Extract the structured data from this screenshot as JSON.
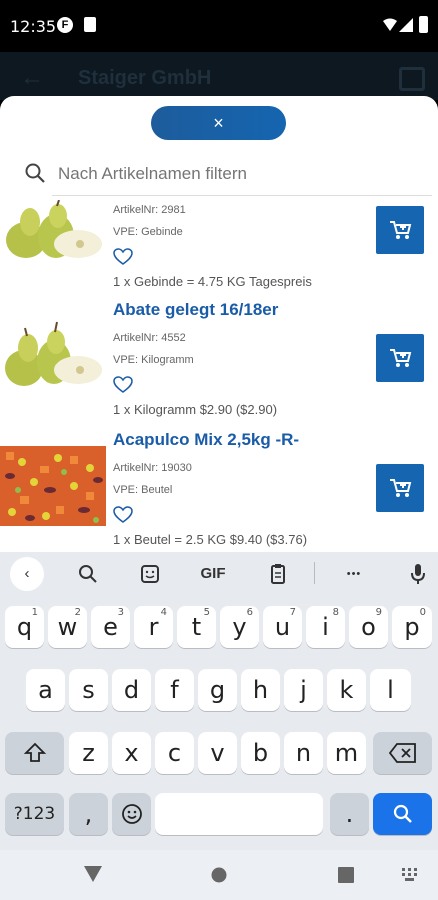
{
  "status": {
    "time": "12:35",
    "app_icon": "F"
  },
  "appbar": {
    "title": "Staiger GmbH"
  },
  "sheet": {
    "close_label": "×",
    "search_placeholder": "Nach Artikelnamen filtern"
  },
  "products": [
    {
      "name": "",
      "artnr": "ArtikelNr: 2981",
      "vpe": "VPE: Gebinde",
      "price": "1 x Gebinde = 4.75 KG Tagespreis"
    },
    {
      "name": "Abate gelegt 16/18er",
      "artnr": "ArtikelNr: 4552",
      "vpe": "VPE: Kilogramm",
      "price": "1 x Kilogramm $2.90 ($2.90)"
    },
    {
      "name": "Acapulco Mix 2,5kg -R-",
      "artnr": "ArtikelNr: 19030",
      "vpe": "VPE: Beutel",
      "price": "1 x Beutel = 2.5 KG  $9.40 ($3.76)"
    }
  ],
  "keyboard": {
    "toolbar": {
      "gif": "GIF",
      "more": "•••"
    },
    "row1": [
      {
        "k": "q",
        "s": "1"
      },
      {
        "k": "w",
        "s": "2"
      },
      {
        "k": "e",
        "s": "3"
      },
      {
        "k": "r",
        "s": "4"
      },
      {
        "k": "t",
        "s": "5"
      },
      {
        "k": "y",
        "s": "6"
      },
      {
        "k": "u",
        "s": "7"
      },
      {
        "k": "i",
        "s": "8"
      },
      {
        "k": "o",
        "s": "9"
      },
      {
        "k": "p",
        "s": "0"
      }
    ],
    "row2": [
      "a",
      "s",
      "d",
      "f",
      "g",
      "h",
      "j",
      "k",
      "l"
    ],
    "row3": [
      "z",
      "x",
      "c",
      "v",
      "b",
      "n",
      "m"
    ],
    "symbols": "?123",
    "comma": ",",
    "period": "."
  },
  "colors": {
    "accent": "#1565b0",
    "product_name": "#1a5ca8",
    "search_key": "#1a73e8"
  }
}
